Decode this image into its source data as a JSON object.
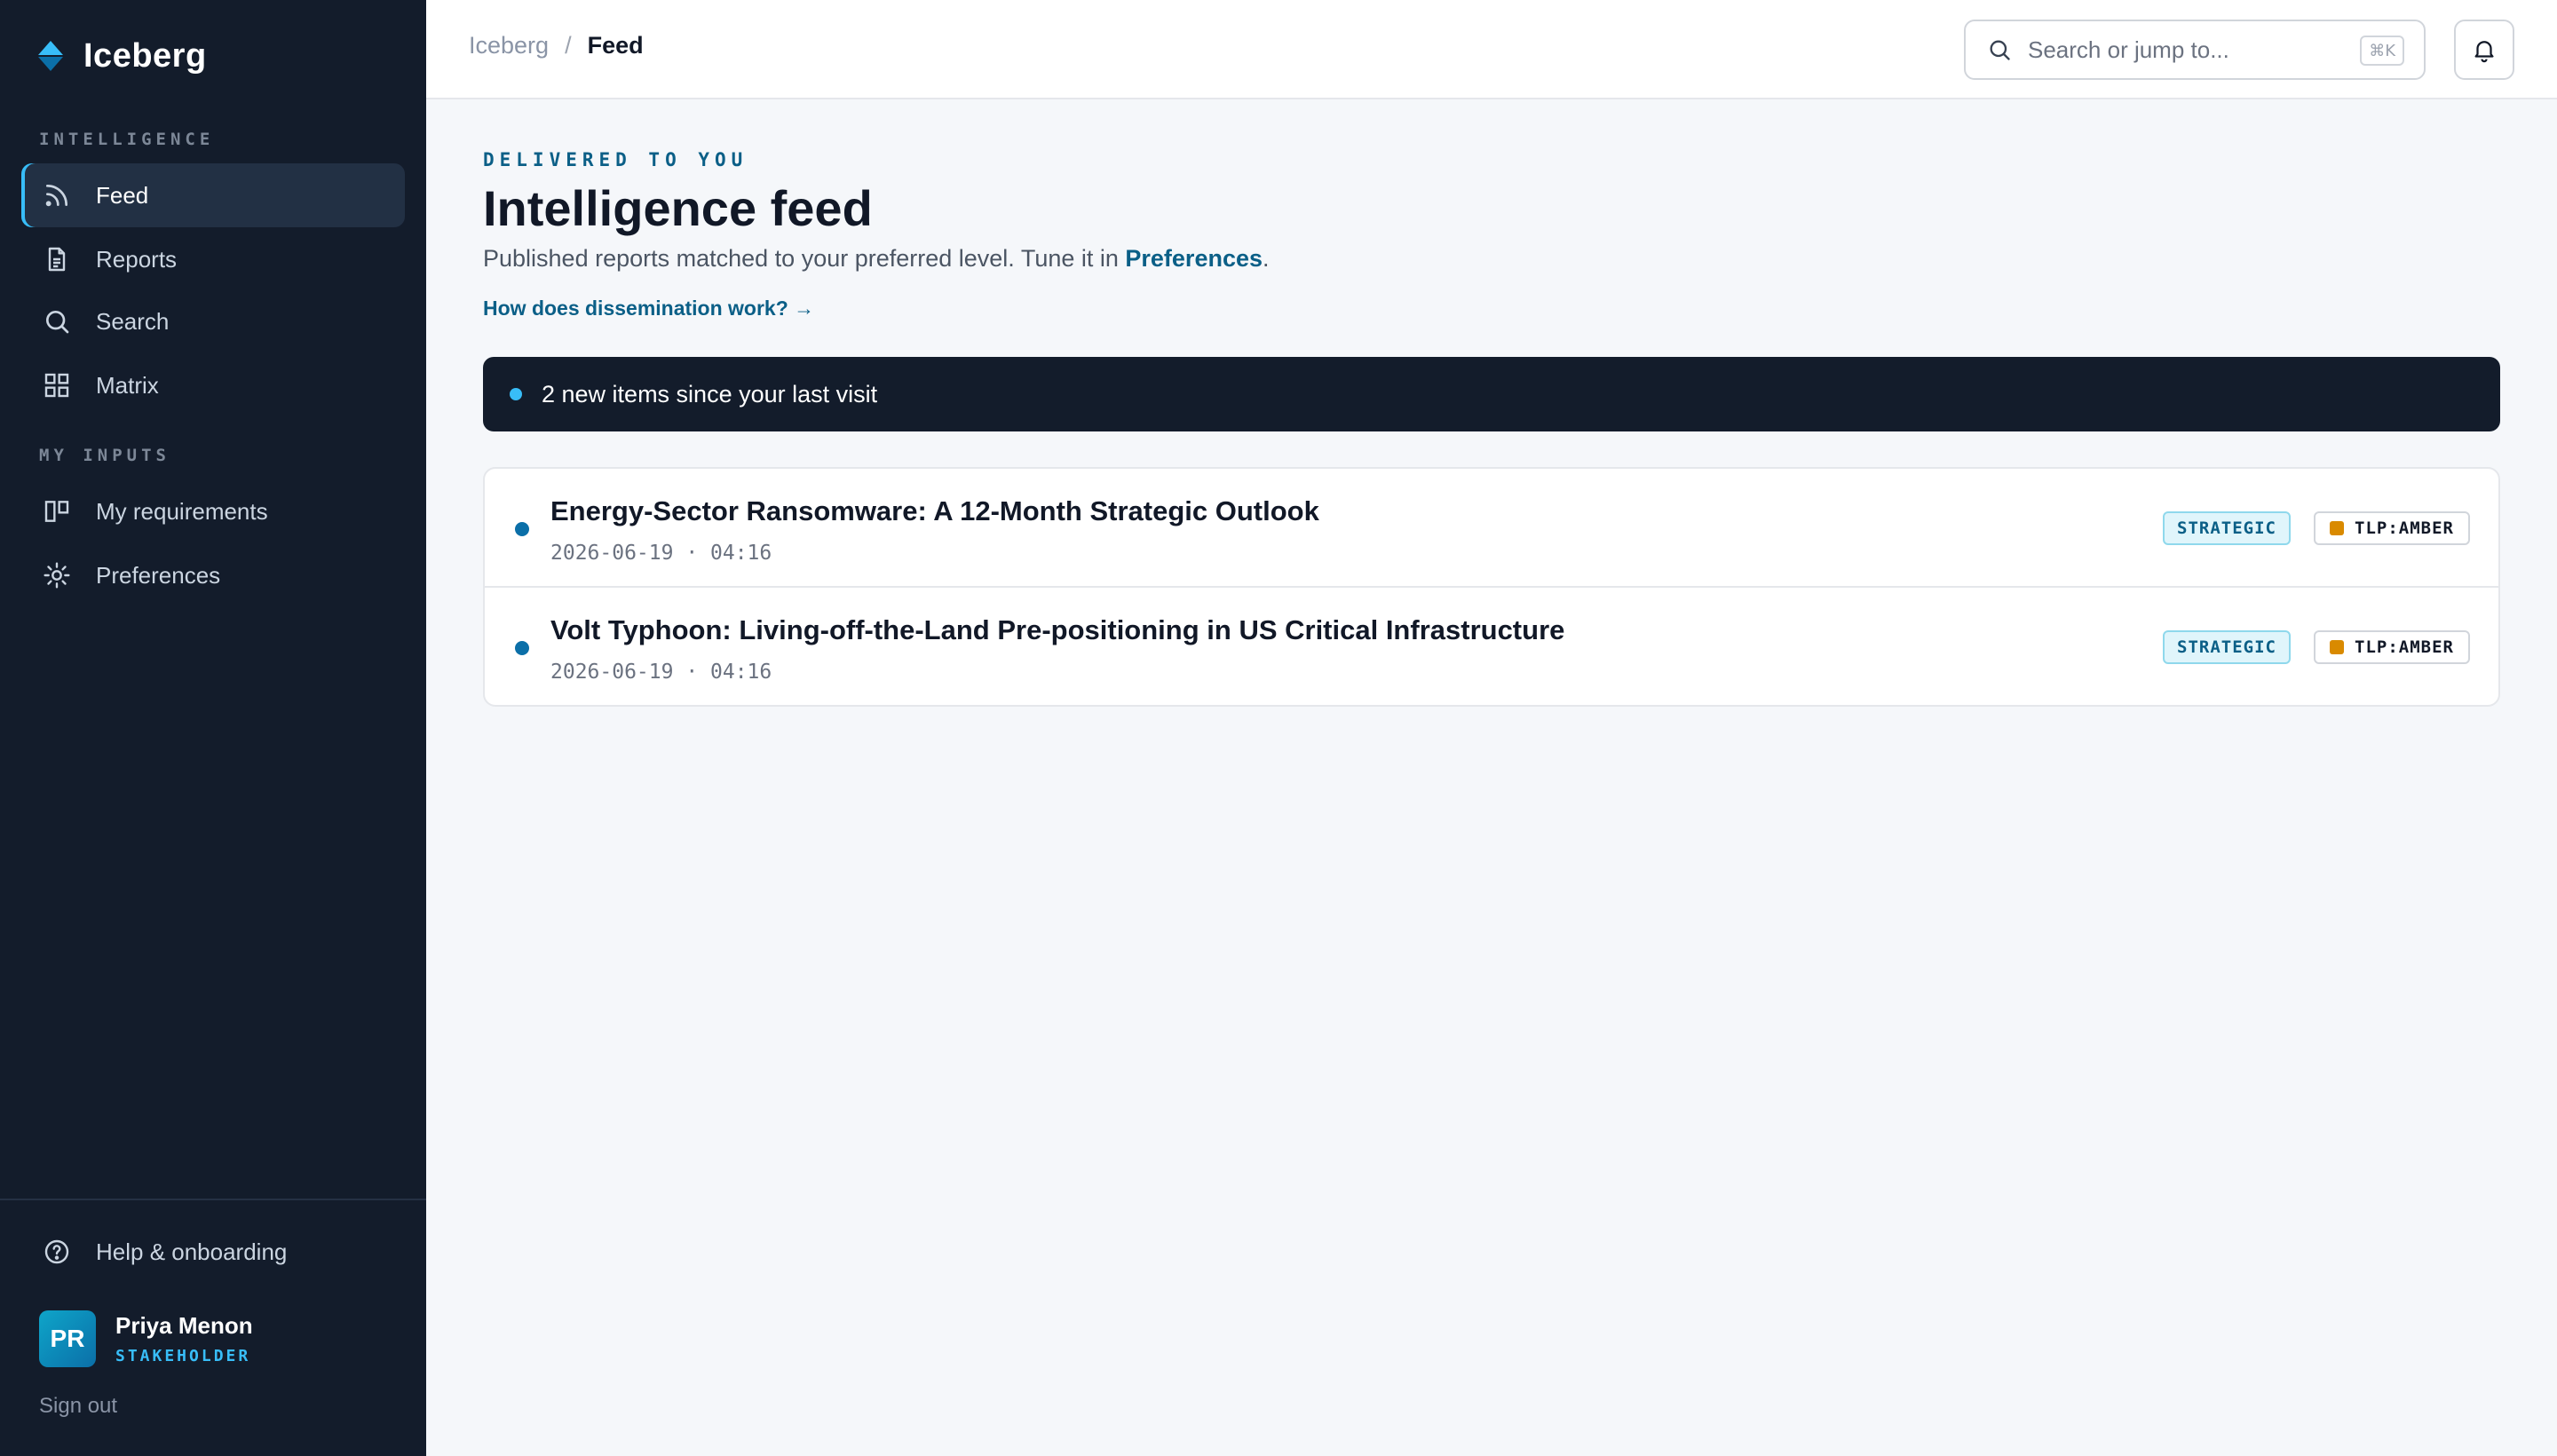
{
  "brand": {
    "name": "Iceberg"
  },
  "sidebar": {
    "sections": [
      {
        "label": "INTELLIGENCE"
      },
      {
        "label": "MY INPUTS"
      }
    ],
    "items": [
      {
        "label": "Feed",
        "icon": "rss-icon",
        "active": true
      },
      {
        "label": "Reports",
        "icon": "document-icon"
      },
      {
        "label": "Search",
        "icon": "search-icon"
      },
      {
        "label": "Matrix",
        "icon": "grid-icon"
      },
      {
        "label": "My requirements",
        "icon": "columns-icon"
      },
      {
        "label": "Preferences",
        "icon": "sun-gear-icon"
      }
    ],
    "help": {
      "label": "Help & onboarding",
      "icon": "help-circle-icon"
    },
    "user": {
      "initials": "PR",
      "name": "Priya Menon",
      "role": "STAKEHOLDER"
    },
    "signout": "Sign out"
  },
  "topbar": {
    "breadcrumb": {
      "root": "Iceberg",
      "separator": "/",
      "current": "Feed"
    },
    "search": {
      "placeholder": "Search or jump to...",
      "shortcut": "⌘K"
    },
    "bell_icon": "bell-icon"
  },
  "main": {
    "eyebrow": "DELIVERED TO YOU",
    "title": "Intelligence feed",
    "subtitle_prefix": "Published reports matched to your preferred level. Tune it in ",
    "subtitle_link": "Preferences",
    "subtitle_suffix": ".",
    "help_link": "How does dissemination work? →",
    "banner": "2 new items since your last visit",
    "items": [
      {
        "title": "Energy-Sector Ransomware: A 12-Month Strategic Outlook",
        "meta": "2026-06-19 · 04:16",
        "level": "STRATEGIC",
        "tlp": "TLP:AMBER"
      },
      {
        "title": "Volt Typhoon: Living-off-the-Land Pre-positioning in US Critical Infrastructure",
        "meta": "2026-06-19 · 04:16",
        "level": "STRATEGIC",
        "tlp": "TLP:AMBER"
      }
    ]
  },
  "colors": {
    "sidebar_bg": "#131c2b",
    "accent": "#0b5f87",
    "accent_light": "#38bdf8",
    "tlp_amber": "#d98a00"
  }
}
